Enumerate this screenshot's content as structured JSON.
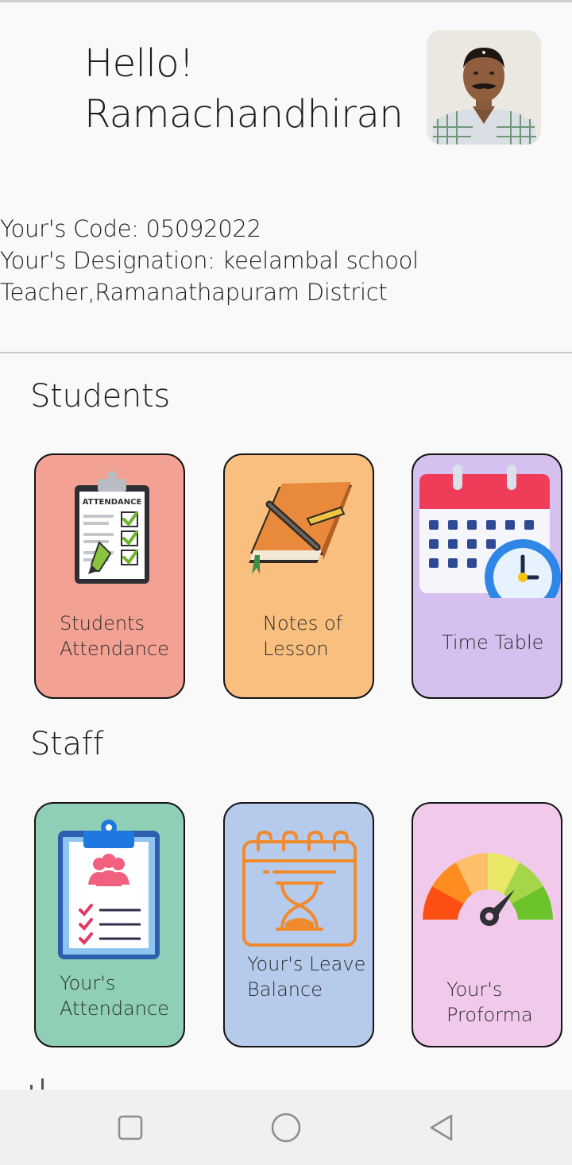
{
  "header": {
    "greeting": "Hello!",
    "name": "Ramachandhiran"
  },
  "profile": {
    "code_line": "Your's Code:  05092022",
    "designation_line1": "Your's Designation:  keelambal school",
    "designation_line2": "Teacher,Ramanathapuram District"
  },
  "students": {
    "title": "Students",
    "cards": [
      {
        "line1": "Students",
        "line2": "Attendance",
        "icon": "attendance-clipboard-icon",
        "color": "#f2a193"
      },
      {
        "line1": "Notes of",
        "line2": "Lesson",
        "icon": "notebook-pen-icon",
        "color": "#f8bf7e"
      },
      {
        "line1": "Time Table",
        "icon": "calendar-clock-icon",
        "color": "#d6c0ef"
      }
    ]
  },
  "staff": {
    "title": "Staff",
    "cards": [
      {
        "line1": "Your's",
        "line2": "Attendance",
        "icon": "staff-clipboard-icon",
        "color": "#8ecfb5"
      },
      {
        "line1": "Your's Leave",
        "line2": "Balance",
        "icon": "calendar-hourglass-icon",
        "color": "#b6caec"
      },
      {
        "line1": "Your's",
        "line2": "Proforma",
        "icon": "gauge-meter-icon",
        "color": "#f1c9ea"
      }
    ]
  },
  "navbar": {
    "icons": [
      "recent-apps-icon",
      "home-icon",
      "back-icon"
    ]
  }
}
